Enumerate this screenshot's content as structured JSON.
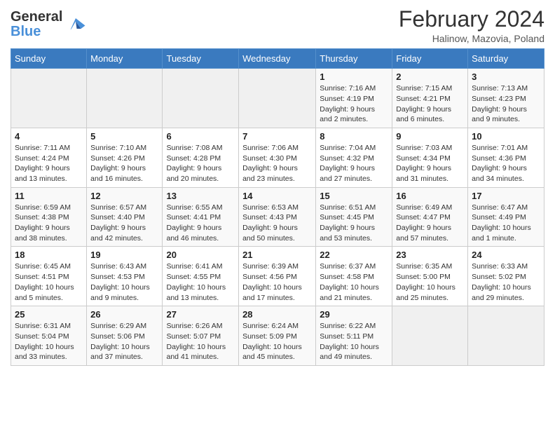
{
  "header": {
    "logo_line1": "General",
    "logo_line2": "Blue",
    "month_year": "February 2024",
    "location": "Halinow, Mazovia, Poland"
  },
  "weekdays": [
    "Sunday",
    "Monday",
    "Tuesday",
    "Wednesday",
    "Thursday",
    "Friday",
    "Saturday"
  ],
  "weeks": [
    [
      {
        "day": "",
        "info": ""
      },
      {
        "day": "",
        "info": ""
      },
      {
        "day": "",
        "info": ""
      },
      {
        "day": "",
        "info": ""
      },
      {
        "day": "1",
        "info": "Sunrise: 7:16 AM\nSunset: 4:19 PM\nDaylight: 9 hours\nand 2 minutes."
      },
      {
        "day": "2",
        "info": "Sunrise: 7:15 AM\nSunset: 4:21 PM\nDaylight: 9 hours\nand 6 minutes."
      },
      {
        "day": "3",
        "info": "Sunrise: 7:13 AM\nSunset: 4:23 PM\nDaylight: 9 hours\nand 9 minutes."
      }
    ],
    [
      {
        "day": "4",
        "info": "Sunrise: 7:11 AM\nSunset: 4:24 PM\nDaylight: 9 hours\nand 13 minutes."
      },
      {
        "day": "5",
        "info": "Sunrise: 7:10 AM\nSunset: 4:26 PM\nDaylight: 9 hours\nand 16 minutes."
      },
      {
        "day": "6",
        "info": "Sunrise: 7:08 AM\nSunset: 4:28 PM\nDaylight: 9 hours\nand 20 minutes."
      },
      {
        "day": "7",
        "info": "Sunrise: 7:06 AM\nSunset: 4:30 PM\nDaylight: 9 hours\nand 23 minutes."
      },
      {
        "day": "8",
        "info": "Sunrise: 7:04 AM\nSunset: 4:32 PM\nDaylight: 9 hours\nand 27 minutes."
      },
      {
        "day": "9",
        "info": "Sunrise: 7:03 AM\nSunset: 4:34 PM\nDaylight: 9 hours\nand 31 minutes."
      },
      {
        "day": "10",
        "info": "Sunrise: 7:01 AM\nSunset: 4:36 PM\nDaylight: 9 hours\nand 34 minutes."
      }
    ],
    [
      {
        "day": "11",
        "info": "Sunrise: 6:59 AM\nSunset: 4:38 PM\nDaylight: 9 hours\nand 38 minutes."
      },
      {
        "day": "12",
        "info": "Sunrise: 6:57 AM\nSunset: 4:40 PM\nDaylight: 9 hours\nand 42 minutes."
      },
      {
        "day": "13",
        "info": "Sunrise: 6:55 AM\nSunset: 4:41 PM\nDaylight: 9 hours\nand 46 minutes."
      },
      {
        "day": "14",
        "info": "Sunrise: 6:53 AM\nSunset: 4:43 PM\nDaylight: 9 hours\nand 50 minutes."
      },
      {
        "day": "15",
        "info": "Sunrise: 6:51 AM\nSunset: 4:45 PM\nDaylight: 9 hours\nand 53 minutes."
      },
      {
        "day": "16",
        "info": "Sunrise: 6:49 AM\nSunset: 4:47 PM\nDaylight: 9 hours\nand 57 minutes."
      },
      {
        "day": "17",
        "info": "Sunrise: 6:47 AM\nSunset: 4:49 PM\nDaylight: 10 hours\nand 1 minute."
      }
    ],
    [
      {
        "day": "18",
        "info": "Sunrise: 6:45 AM\nSunset: 4:51 PM\nDaylight: 10 hours\nand 5 minutes."
      },
      {
        "day": "19",
        "info": "Sunrise: 6:43 AM\nSunset: 4:53 PM\nDaylight: 10 hours\nand 9 minutes."
      },
      {
        "day": "20",
        "info": "Sunrise: 6:41 AM\nSunset: 4:55 PM\nDaylight: 10 hours\nand 13 minutes."
      },
      {
        "day": "21",
        "info": "Sunrise: 6:39 AM\nSunset: 4:56 PM\nDaylight: 10 hours\nand 17 minutes."
      },
      {
        "day": "22",
        "info": "Sunrise: 6:37 AM\nSunset: 4:58 PM\nDaylight: 10 hours\nand 21 minutes."
      },
      {
        "day": "23",
        "info": "Sunrise: 6:35 AM\nSunset: 5:00 PM\nDaylight: 10 hours\nand 25 minutes."
      },
      {
        "day": "24",
        "info": "Sunrise: 6:33 AM\nSunset: 5:02 PM\nDaylight: 10 hours\nand 29 minutes."
      }
    ],
    [
      {
        "day": "25",
        "info": "Sunrise: 6:31 AM\nSunset: 5:04 PM\nDaylight: 10 hours\nand 33 minutes."
      },
      {
        "day": "26",
        "info": "Sunrise: 6:29 AM\nSunset: 5:06 PM\nDaylight: 10 hours\nand 37 minutes."
      },
      {
        "day": "27",
        "info": "Sunrise: 6:26 AM\nSunset: 5:07 PM\nDaylight: 10 hours\nand 41 minutes."
      },
      {
        "day": "28",
        "info": "Sunrise: 6:24 AM\nSunset: 5:09 PM\nDaylight: 10 hours\nand 45 minutes."
      },
      {
        "day": "29",
        "info": "Sunrise: 6:22 AM\nSunset: 5:11 PM\nDaylight: 10 hours\nand 49 minutes."
      },
      {
        "day": "",
        "info": ""
      },
      {
        "day": "",
        "info": ""
      }
    ]
  ]
}
